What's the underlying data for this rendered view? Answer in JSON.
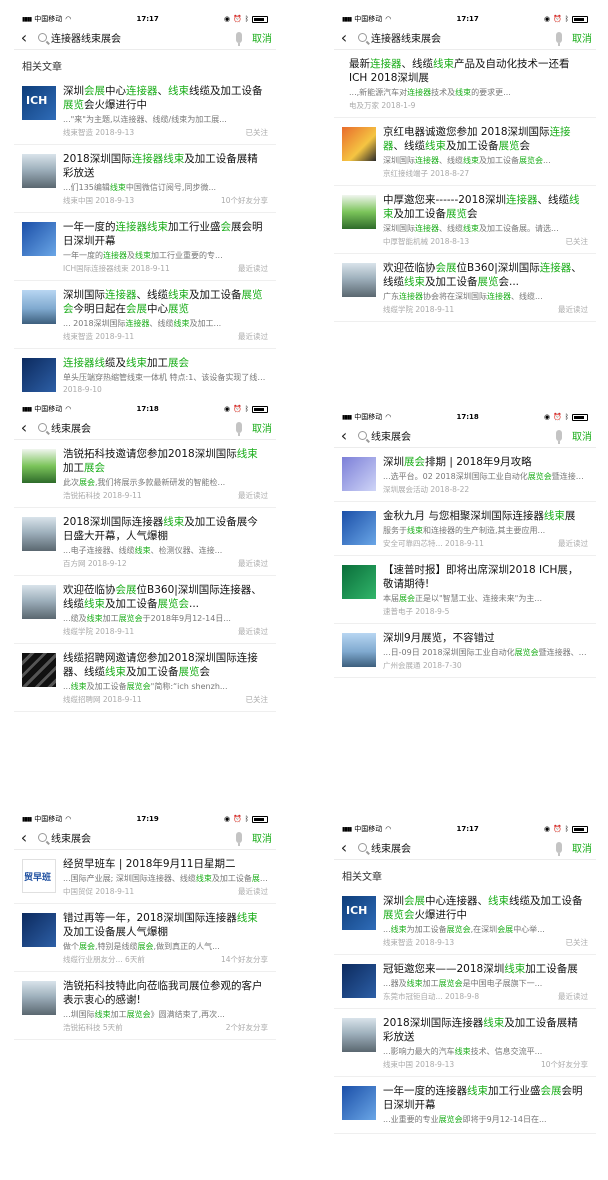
{
  "panels": [
    {
      "status": {
        "carrier": "中国移动",
        "time": "17:17"
      },
      "query": "连接器线束展会",
      "cancel": "取消",
      "section": "相关文章",
      "items": [
        {
          "thumb": "ich",
          "title_html": "深圳<span class=\"hl\">会展</span>中心<span class=\"hl\">连接器</span>、<span class=\"hl\">线束</span>线缆及加工设备<span class=\"hl\">展览</span>会火爆进行中",
          "snippet": "...\"来\"为主题,以连接器、线缆/线束为加工展...",
          "source": "线束智造",
          "date": "2018-9-13",
          "right": "已关注"
        },
        {
          "thumb": "hall",
          "title_html": "2018深圳国际<span class=\"hl\">连接器线束</span>及加工设备展精彩放送",
          "snippet": "...们135编辑<span class=\"hl\">线束</span>中国微信订阅号,同步微...",
          "source": "线束中国",
          "date": "2018-9-13",
          "right": "10个好友分享"
        },
        {
          "thumb": "blue",
          "title_html": "一年一度的<span class=\"hl\">连接器线束</span>加工行业盛<span class=\"hl\">会</span>展会明日深圳开幕",
          "snippet": "一年一度的<span class=\"hl\">连接器</span>及<span class=\"hl\">线束</span>加工行业重要的专...",
          "source": "ICH国际连接器线束",
          "date": "2018-9-11",
          "right": "最近读过"
        },
        {
          "thumb": "city",
          "title_html": "深圳国际<span class=\"hl\">连接器</span>、线缆<span class=\"hl\">线束</span>及加工设备<span class=\"hl\">展览会</span>今明日起在<span class=\"hl\">会展</span>中心<span class=\"hl\">展览</span>",
          "snippet": "... 2018深圳国际<span class=\"hl\">连接器</span>、线缆<span class=\"hl\">线束</span>及加工...",
          "source": "线束智造",
          "date": "2018-9-11",
          "right": "最近读过"
        },
        {
          "thumb": "navy",
          "title_html": "<span class=\"hl\">连接器线</span>缆及<span class=\"hl\">线束</span>加工<span class=\"hl\">展会</span>",
          "snippet": "单头压端穿热缩管线束一体机 特点:1、该设备实现了线材拉线、切断、一端剥皮拔线沾锡,...",
          "source": "",
          "date": "2018-9-10",
          "right": ""
        }
      ]
    },
    {
      "status": {
        "carrier": "中国移动",
        "time": "17:17"
      },
      "query": "连接器线束展会",
      "cancel": "取消",
      "section": "",
      "items": [
        {
          "thumb": "none",
          "title_html": "最新<span class=\"hl\">连接器</span>、线缆<span class=\"hl\">线束</span>产品及自动化技术一还看 ICH 2018深圳展",
          "snippet": "...,新能源汽车对<span class=\"hl\">连接器</span>技术及<span class=\"hl\">线束</span>的要求更...",
          "source": "电及万家",
          "date": "2018-1-9",
          "right": ""
        },
        {
          "thumb": "red",
          "title_html": "京红电器诚邀您参加 2018深圳国际<span class=\"hl\">连接器</span>、线缆<span class=\"hl\">线束</span>及加工设备<span class=\"hl\">展览</span>会",
          "snippet": "深圳国际<span class=\"hl\">连接器</span>、线缆<span class=\"hl\">线束</span>及加工设备<span class=\"hl\">展览会</span>...",
          "source": "京红接线端子",
          "date": "2018-8-27",
          "right": ""
        },
        {
          "thumb": "booth",
          "title_html": "中厚邀您来------2018深圳<span class=\"hl\">连接器</span>、线缆<span class=\"hl\">线束</span>及加工设备<span class=\"hl\">展览</span>会",
          "snippet": "深圳国际<span class=\"hl\">连接器</span>、线缆<span class=\"hl\">线束</span>及加工设备展。请选...",
          "source": "中厚智能机械",
          "date": "2018-8-13",
          "right": "已关注"
        },
        {
          "thumb": "hall",
          "title_html": "欢迎莅临协<span class=\"hl\">会展</span>位B360|深圳国际<span class=\"hl\">连接器</span>、线缆<span class=\"hl\">线束</span>及加工设备<span class=\"hl\">展览</span>会...",
          "snippet": "广东<span class=\"hl\">连接器</span>协会将在深圳国际<span class=\"hl\">连接器</span>、线缆...",
          "source": "线缆学院",
          "date": "2018-9-11",
          "right": "最近读过"
        }
      ]
    },
    {
      "status": {
        "carrier": "中国移动",
        "time": "17:18"
      },
      "query": "线束展会",
      "cancel": "取消",
      "section": "",
      "items": [
        {
          "thumb": "booth",
          "title_html": "浩锐拓科技邀请您参加2018深圳国际<span class=\"hl\">线束</span>加工<span class=\"hl\">展会</span>",
          "snippet": "此次<span class=\"hl\">展会</span>,我们将展示多款最新研发的智能检...",
          "source": "浩锐拓科技",
          "date": "2018-9-11",
          "right": "最近读过"
        },
        {
          "thumb": "hall",
          "title_html": "2018深圳国际连接器<span class=\"hl\">线束</span>及加工设备展今日盛大开幕，人气爆棚",
          "snippet": "...电子连接器、线缆<span class=\"hl\">线束</span>、检测仪器、连接...",
          "source": "百方网",
          "date": "2018-9-12",
          "right": "最近读过"
        },
        {
          "thumb": "hall",
          "title_html": "欢迎莅临协<span class=\"hl\">会展</span>位B360|深圳国际连接器、线缆<span class=\"hl\">线束</span>及加工设备<span class=\"hl\">展览会</span>...",
          "snippet": "...缆及<span class=\"hl\">线束</span>加工<span class=\"hl\">展览会</span>于2018年9月12-14日...",
          "source": "线缆学院",
          "date": "2018-9-11",
          "right": "最近读过"
        },
        {
          "thumb": "cable",
          "title_html": "线缆招聘网邀请您参加2018深圳国际连接器、线缆<span class=\"hl\">线束</span>及加工设备<span class=\"hl\">展览</span>会",
          "snippet": "...<span class=\"hl\">线束</span>及加工设备<span class=\"hl\">展览会</span>\"简称:“ich shenzh...",
          "source": "线缆招聘网",
          "date": "2018-9-11",
          "right": "已关注"
        }
      ]
    },
    {
      "status": {
        "carrier": "中国移动",
        "time": "17:18"
      },
      "query": "线束展会",
      "cancel": "取消",
      "section": "",
      "items": [
        {
          "thumb": "purple",
          "title_html": "深圳<span class=\"hl\">展会</span>排期 | 2018年9月攻略",
          "snippet": "...选平台。02 2018深圳国际工业自动化<span class=\"hl\">展览会</span>暨连接器、线缆及<span class=\"hl\">线束</span>设备<span class=\"hl\">展览会</span>?观众...",
          "source": "深圳展会活动",
          "date": "2018-8-22",
          "right": ""
        },
        {
          "thumb": "blue",
          "title_html": "金秋九月 与您相聚深圳国际连接器<span class=\"hl\">线束</span>展",
          "snippet": "服务于<span class=\"hl\">线束</span>和连接器的生产制造,其主要应用...",
          "source": "安全可靠四芯特...",
          "date": "2018-9-11",
          "right": "最近读过"
        },
        {
          "thumb": "green",
          "title_html": "【速普时报】即将出席深圳2018 ICH展，敬请期待!",
          "snippet": "本届<span class=\"hl\">展会</span>正是以\"智慧工业、连接未来\"为主...",
          "source": "速普电子",
          "date": "2018-9-5",
          "right": ""
        },
        {
          "thumb": "city",
          "title_html": "深圳9月展览，不容错过",
          "snippet": "...日-09日 2018深圳国际工业自动化<span class=\"hl\">展览会</span>暨连接器、线缆及<span class=\"hl\">线束</span>设备<span class=\"hl\">展览会</span>(...",
          "source": "广州会展通",
          "date": "2018-7-30",
          "right": ""
        }
      ]
    },
    {
      "status": {
        "carrier": "中国移动",
        "time": "17:19"
      },
      "query": "线束展会",
      "cancel": "取消",
      "section": "",
      "items": [
        {
          "thumb": "trade",
          "title_html": "经贸早班车 | 2018年9月11日星期二",
          "snippet": "...国际产业展; 深圳国际连接器、线缆<span class=\"hl\">线束</span>及加工设备<span class=\"hl\">展览会</span> 中国:将提高机电等产品出...",
          "source": "中国贸促",
          "date": "2018-9-11",
          "right": "最近读过"
        },
        {
          "thumb": "navy",
          "title_html": "错过再等一年，2018深圳国际连接器<span class=\"hl\">线束</span>及加工设备展人气爆棚",
          "snippet": "做个<span class=\"hl\">展会</span>,特别是线缆<span class=\"hl\">展会</span>,做到真正的人气...",
          "source": "线缆行业朋友分...",
          "date": "6天前",
          "right": "14个好友分享"
        },
        {
          "thumb": "hall",
          "title_html": "浩锐拓科技特此向莅临我司展位参观的客户表示衷心的感谢!",
          "snippet": "...圳国际<span class=\"hl\">线束</span>加工<span class=\"hl\">展览会</span>》圆满结束了,再次...",
          "source": "浩锐拓科技",
          "date": "5天前",
          "right": "2个好友分享"
        }
      ]
    },
    {
      "status": {
        "carrier": "中国移动",
        "time": "17:17"
      },
      "query": "线束展会",
      "cancel": "取消",
      "section": "相关文章",
      "items": [
        {
          "thumb": "ich",
          "title_html": "深圳<span class=\"hl\">会展</span>中心连接器、<span class=\"hl\">线束</span>线缆及加工设备<span class=\"hl\">展览会</span>火爆进行中",
          "snippet": "...<span class=\"hl\">线束</span>为加工设备<span class=\"hl\">展览会</span>,在深圳<span class=\"hl\">会展</span>中心举...",
          "source": "线束智造",
          "date": "2018-9-13",
          "right": "已关注"
        },
        {
          "thumb": "navy",
          "title_html": "冠钜邀您来——2018深圳<span class=\"hl\">线束</span>加工设备展",
          "snippet": "...器及<span class=\"hl\">线束</span>加工<span class=\"hl\">展览会</span>是中国电子展旗下一...",
          "source": "东莞市冠钜自动...",
          "date": "2018-9-8",
          "right": "最近读过"
        },
        {
          "thumb": "hall",
          "title_html": "2018深圳国际连接器<span class=\"hl\">线束</span>及加工设备展精彩放送",
          "snippet": "...影响力最大的汽车<span class=\"hl\">线束</span>技术、信息交流平...",
          "source": "线束中国",
          "date": "2018-9-13",
          "right": "10个好友分享"
        },
        {
          "thumb": "blue",
          "title_html": "一年一度的连接器<span class=\"hl\">线束</span>加工行业盛<span class=\"hl\">会</span><span class=\"hl\">展</span>会明日深圳开幕",
          "snippet": "...业重要的专业<span class=\"hl\">展览会</span>即将于9月12-14日在...",
          "source": "",
          "date": "",
          "right": ""
        }
      ]
    }
  ]
}
